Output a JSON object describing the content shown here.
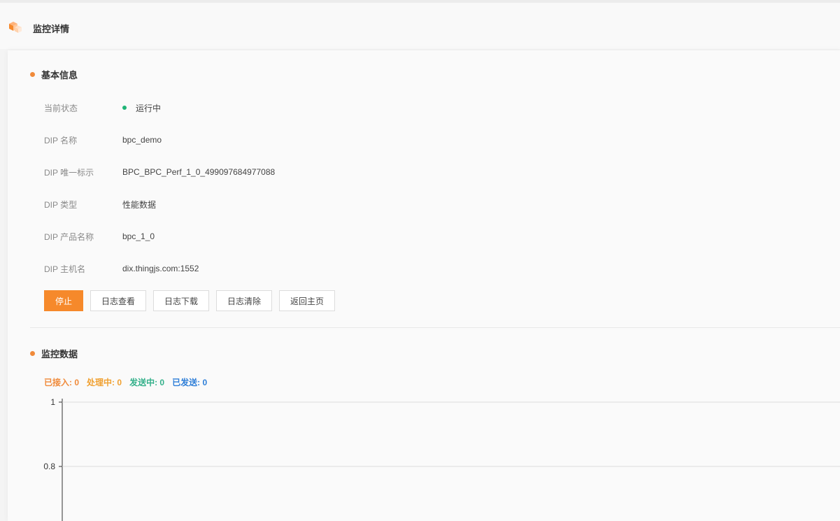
{
  "page": {
    "title": "监控详情"
  },
  "basic_info": {
    "section_title": "基本信息",
    "rows": [
      {
        "label": "当前状态",
        "value": "运行中"
      },
      {
        "label": "DIP 名称",
        "value": "bpc_demo"
      },
      {
        "label": "DIP 唯一标示",
        "value": "BPC_BPC_Perf_1_0_499097684977088"
      },
      {
        "label": "DIP 类型",
        "value": "性能数据"
      },
      {
        "label": "DIP 产品名称",
        "value": "bpc_1_0"
      },
      {
        "label": "DIP 主机名",
        "value": "dix.thingjs.com:1552"
      }
    ],
    "status_color": "#1fb476"
  },
  "actions": {
    "stop": "停止",
    "log_view": "日志查看",
    "log_download": "日志下载",
    "log_clear": "日志清除",
    "back_home": "返回主页"
  },
  "monitor": {
    "section_title": "监控数据",
    "stats": [
      {
        "label": "已接入: ",
        "value": "0",
        "color": "#f08a3a"
      },
      {
        "label": "处理中: ",
        "value": "0",
        "color": "#f0a030"
      },
      {
        "label": "发送中: ",
        "value": "0",
        "color": "#33b08a"
      },
      {
        "label": "已发送: ",
        "value": "0",
        "color": "#2f7fd8"
      }
    ]
  },
  "chart_data": {
    "type": "line",
    "series": [],
    "y_ticks": [
      "1",
      "0.8"
    ],
    "ylim_visible": [
      0.8,
      1
    ],
    "grid": true
  },
  "colors": {
    "accent": "#f6892b",
    "section_dot": "#f08a3a"
  }
}
